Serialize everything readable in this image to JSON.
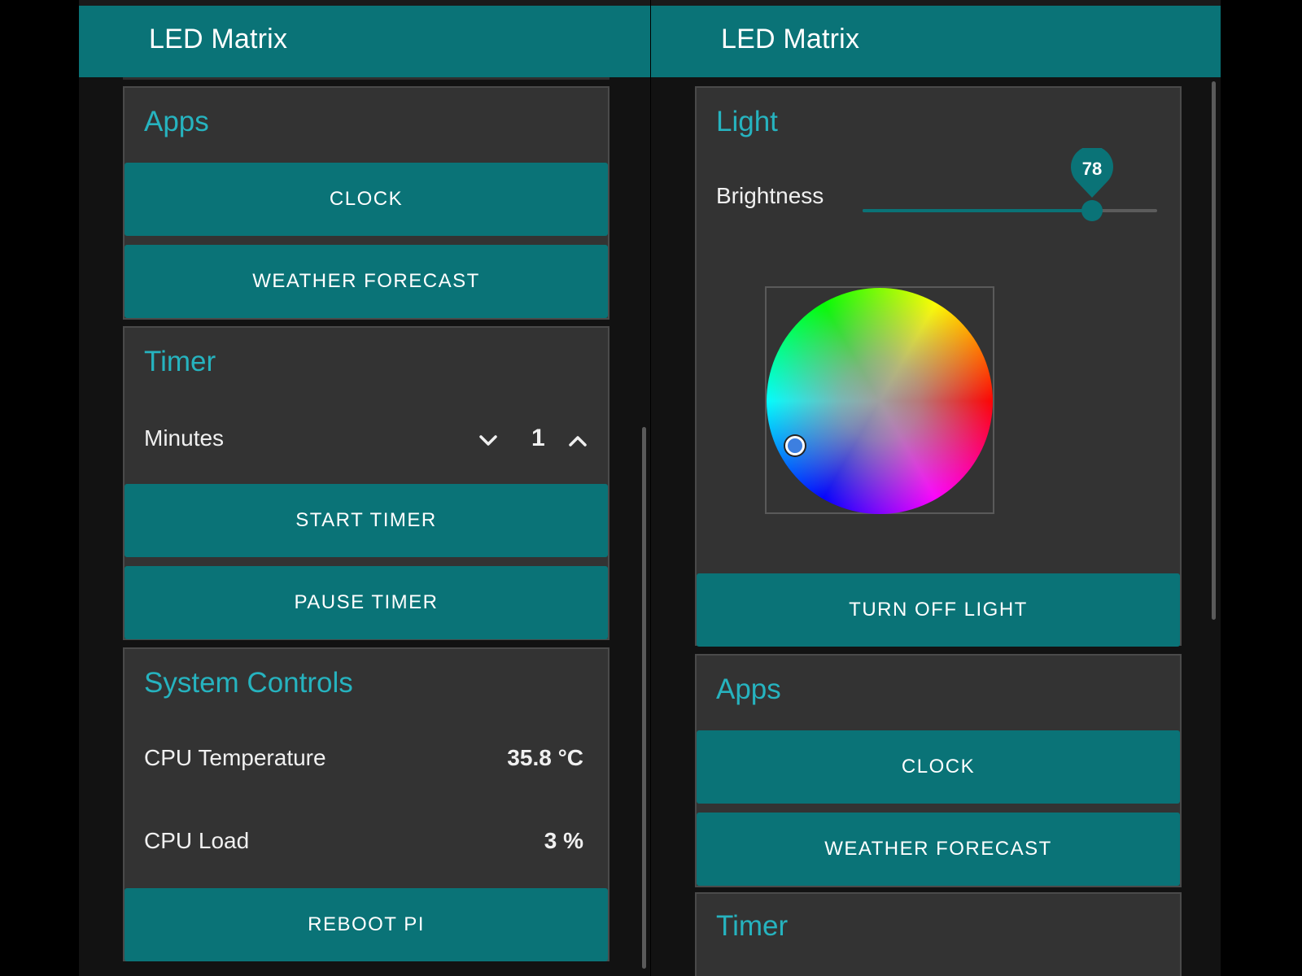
{
  "left": {
    "app_title": "LED Matrix",
    "apps": {
      "title": "Apps",
      "clock_label": "CLOCK",
      "weather_label": "WEATHER FORECAST"
    },
    "timer": {
      "title": "Timer",
      "minutes_label": "Minutes",
      "minutes_value": "1",
      "start_label": "START TIMER",
      "pause_label": "PAUSE TIMER"
    },
    "system": {
      "title": "System Controls",
      "cpu_temp_label": "CPU Temperature",
      "cpu_temp_value": "35.8 °C",
      "cpu_load_label": "CPU Load",
      "cpu_load_value": "3 %",
      "reboot_label": "REBOOT PI"
    }
  },
  "right": {
    "app_title": "LED Matrix",
    "light": {
      "title": "Light",
      "brightness_label": "Brightness",
      "brightness_value": "78",
      "brightness_fraction": 0.78,
      "turn_off_label": "TURN OFF LIGHT"
    },
    "apps": {
      "title": "Apps",
      "clock_label": "CLOCK",
      "weather_label": "WEATHER FORECAST"
    },
    "timer": {
      "title": "Timer"
    }
  },
  "colors": {
    "accent": "#0a7377",
    "section_title": "#26b3bf",
    "card_bg": "#333333",
    "page_bg": "#121212",
    "selected_color": "#3d7fe0"
  },
  "icons": {
    "decrement": "chevron-down-icon",
    "increment": "chevron-up-icon"
  }
}
